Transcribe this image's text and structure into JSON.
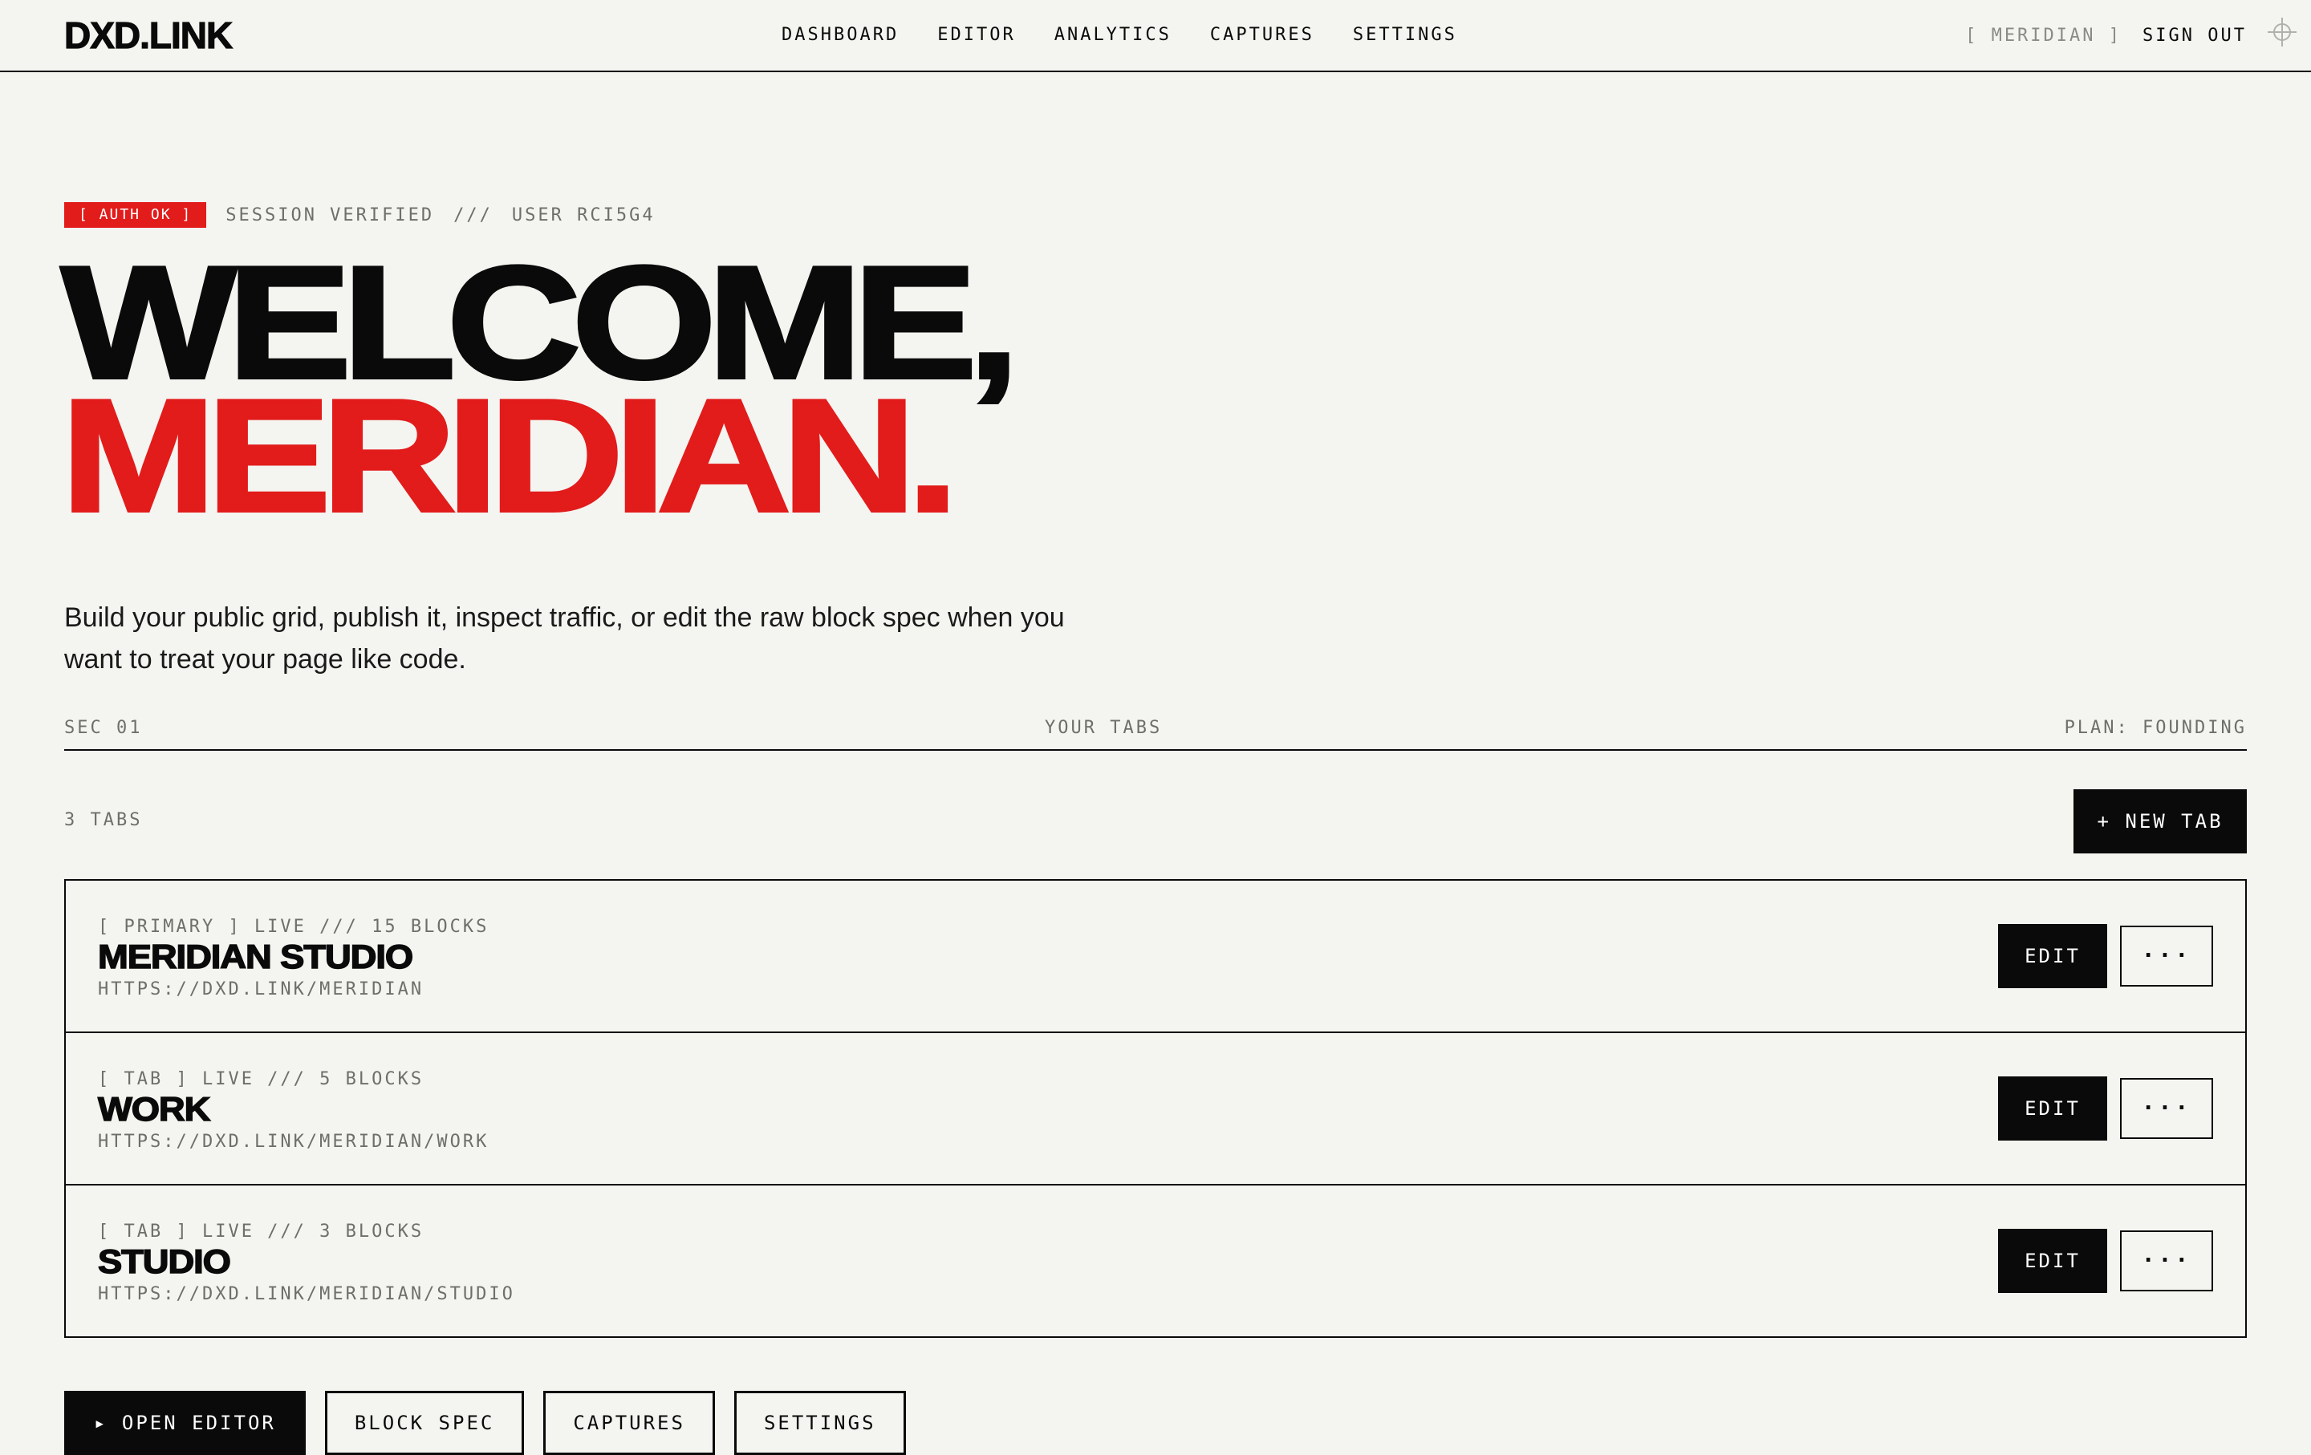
{
  "app": {
    "logo": "DXD.LINK"
  },
  "nav": [
    "DASHBOARD",
    "EDITOR",
    "ANALYTICS",
    "CAPTURES",
    "SETTINGS"
  ],
  "account": {
    "user": "[ MERIDIAN ]",
    "signout": "SIGN OUT"
  },
  "status": {
    "badge": "[ AUTH OK ]",
    "text": "SESSION VERIFIED",
    "sep": "///",
    "user": "USER RCI5G4"
  },
  "hero": {
    "line1": "WELCOME,",
    "line2": "MERIDIAN."
  },
  "lede": "Build your public grid, publish it, inspect traffic, or edit the raw block spec when you want to treat your page like code.",
  "section": {
    "left": "SEC 01",
    "center": "YOUR TABS",
    "right": "PLAN: FOUNDING"
  },
  "tabs_count": "3 TABS",
  "new_tab": "+ NEW TAB",
  "tabs": [
    {
      "meta": "[ PRIMARY ] LIVE /// 15 BLOCKS",
      "name": "MERIDIAN STUDIO",
      "url": "HTTPS://DXD.LINK/MERIDIAN",
      "edit": "EDIT",
      "more": "···"
    },
    {
      "meta": "[ TAB ] LIVE /// 5 BLOCKS",
      "name": "WORK",
      "url": "HTTPS://DXD.LINK/MERIDIAN/WORK",
      "edit": "EDIT",
      "more": "···"
    },
    {
      "meta": "[ TAB ] LIVE /// 3 BLOCKS",
      "name": "STUDIO",
      "url": "HTTPS://DXD.LINK/MERIDIAN/STUDIO",
      "edit": "EDIT",
      "more": "···"
    }
  ],
  "actions": [
    "▸ OPEN EDITOR",
    "BLOCK SPEC",
    "CAPTURES",
    "SETTINGS"
  ],
  "colors": {
    "accent": "#e21b1b",
    "ink": "#0a0a0a",
    "paper": "#f4f4f0",
    "muted": "#6e6e6a"
  },
  "icons": {
    "crosshair": "crosshair-icon"
  }
}
